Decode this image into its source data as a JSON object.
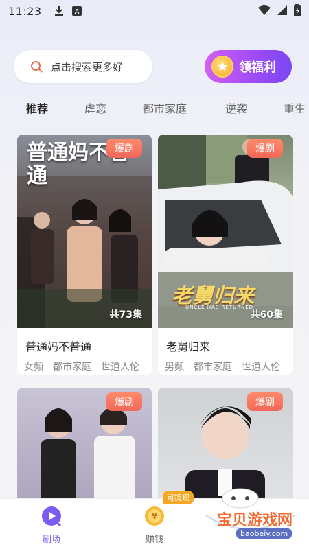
{
  "status": {
    "time": "11:23"
  },
  "search": {
    "placeholder": "点击搜索更多好"
  },
  "welfare": {
    "label": "领福利"
  },
  "tabs": [
    {
      "label": "推荐",
      "active": true
    },
    {
      "label": "虐恋",
      "active": false
    },
    {
      "label": "都市家庭",
      "active": false
    },
    {
      "label": "逆袭",
      "active": false
    },
    {
      "label": "重生",
      "active": false
    }
  ],
  "cards": [
    {
      "badge": "爆剧",
      "poster_text": "普通妈不普通",
      "episodes": "共73集",
      "title": "普通妈不普通",
      "tags": [
        "女频",
        "都市家庭",
        "世道人伦"
      ]
    },
    {
      "badge": "爆剧",
      "poster_text": "老舅归来",
      "poster_subtext": "UNCLE HAS RETURNED",
      "episodes": "共60集",
      "title": "老舅归来",
      "tags": [
        "男频",
        "都市家庭",
        "世道人伦"
      ]
    },
    {
      "badge": "爆剧"
    },
    {
      "badge": "爆剧"
    }
  ],
  "nav": [
    {
      "label": "剧场",
      "active": true
    },
    {
      "label": "赚钱",
      "active": false,
      "badge": "可提现"
    }
  ],
  "watermark": {
    "text": "宝贝游戏网",
    "url": "baobeiy.com"
  },
  "colors": {
    "accent": "#7b5cf0",
    "badge": "#f2675a",
    "welfare_start": "#d55ef4",
    "welfare_end": "#7b47f2"
  }
}
